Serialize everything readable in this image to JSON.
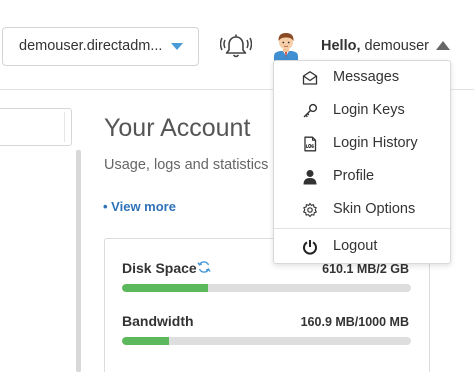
{
  "header": {
    "domain_select": {
      "value": "demouser.directadm..."
    },
    "greeting": {
      "hello": "Hello,",
      "username": "demouser"
    }
  },
  "main": {
    "title": "Your Account",
    "subtitle": "Usage, logs and statistics",
    "view_more": "• View more",
    "usage": [
      {
        "label": "Disk Space",
        "value": "610.1 MB/2 GB",
        "fraction": 0.298
      },
      {
        "label": "Bandwidth",
        "value": "160.9 MB/1000 MB",
        "fraction": 0.161
      }
    ]
  },
  "user_menu": {
    "items": [
      {
        "label": "Messages",
        "icon": "envelope-icon"
      },
      {
        "label": "Login Keys",
        "icon": "key-icon"
      },
      {
        "label": "Login History",
        "icon": "log-icon"
      },
      {
        "label": "Profile",
        "icon": "user-icon"
      },
      {
        "label": "Skin Options",
        "icon": "gear-icon"
      },
      {
        "label": "Logout",
        "icon": "power-icon"
      }
    ]
  },
  "colors": {
    "accent": "#4a9ad8",
    "link": "#2f72b8",
    "progress": "#5cb85c"
  }
}
